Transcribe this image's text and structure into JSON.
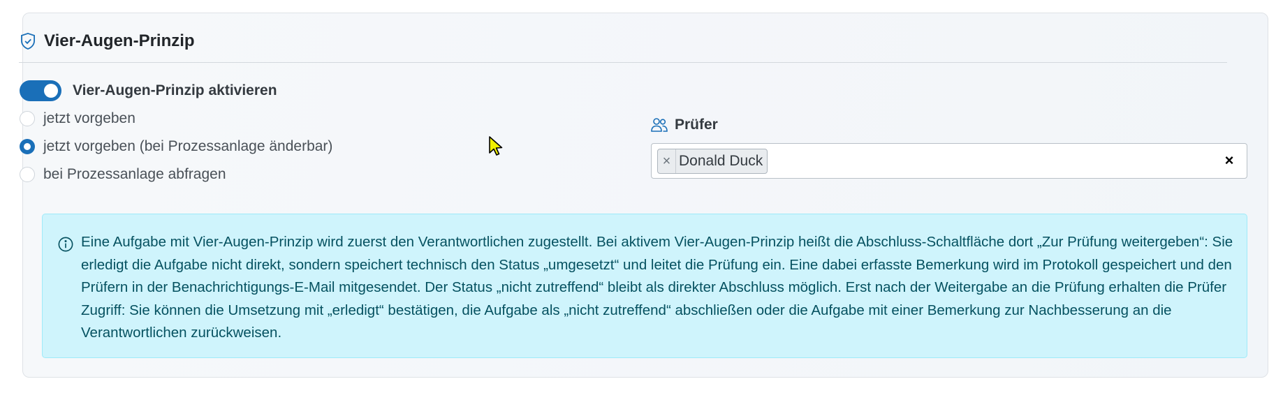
{
  "section": {
    "title": "Vier-Augen-Prinzip",
    "header_icon": "shield-check-icon"
  },
  "toggle": {
    "label": "Vier-Augen-Prinzip aktivieren",
    "state": "on",
    "color": "#1a6fb8"
  },
  "options": [
    {
      "label": "jetzt vorgeben",
      "selected": false
    },
    {
      "label": "jetzt vorgeben (bei Prozessanlage änderbar)",
      "selected": true
    },
    {
      "label": "bei Prozessanlage abfragen",
      "selected": false
    }
  ],
  "pruefer": {
    "label": "Prüfer",
    "icon": "people-icon",
    "selected_tags": [
      "Donald Duck"
    ],
    "tag_remove_glyph": "×",
    "clear_glyph": "×"
  },
  "info": {
    "icon": "info-circle-icon",
    "text": "Eine Aufgabe mit Vier-Augen-Prinzip wird zuerst den Verantwortlichen zugestellt. Bei aktivem Vier-Augen-Prinzip heißt die Abschluss-Schaltfläche dort „Zur Prüfung weitergeben“: Sie erledigt die Aufgabe nicht direkt, sondern speichert technisch den Status „umgesetzt“ und leitet die Prüfung ein. Eine dabei erfasste Bemerkung wird im Protokoll gespeichert und den Prüfern in der Benachrichtigungs-E-Mail mitgesendet. Der Status „nicht zutreffend“ bleibt als direkter Abschluss möglich. Erst nach der Weitergabe an die Prüfung erhalten die Prüfer Zugriff: Sie können die Umsetzung mit „erledigt“ bestätigen, die Aufgabe als „nicht zutreffend“ abschließen oder die Aufgabe mit einer Bemerkung zur Nachbesserung an die Verantwortlichen zurückweisen.",
    "background": "#cff4fc",
    "text_color": "#055160"
  }
}
